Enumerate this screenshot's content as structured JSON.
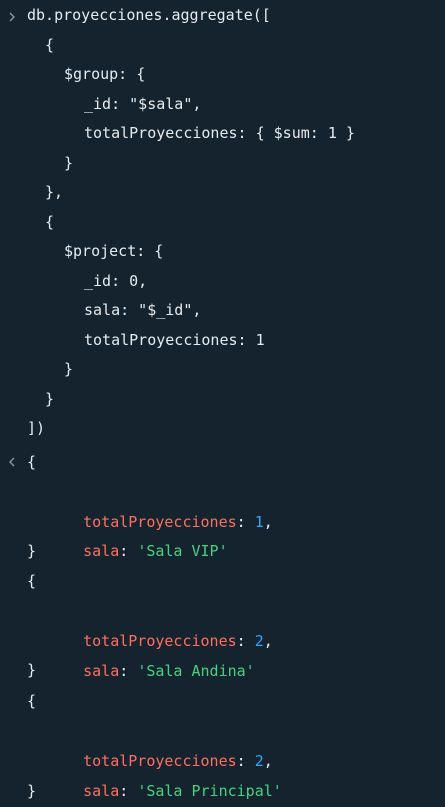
{
  "shell": {
    "prompt_icon": "chevron-right-icon",
    "result_icon": "chevron-left-icon",
    "command_lines": [
      "db.proyecciones.aggregate([",
      "{",
      "$group: {",
      "_id: \"$sala\",",
      "totalProyecciones: { $sum: 1 }",
      "}",
      "},",
      "{",
      "$project: {",
      "_id: 0,",
      "sala: \"$_id\",",
      "totalProyecciones: 1",
      "}",
      "}",
      "])"
    ],
    "results": [
      {
        "open": "{",
        "key1": "totalProyecciones",
        "sep1": ": ",
        "val1": "1",
        "tail1": ",",
        "key2": "sala",
        "sep2": ": ",
        "val2": "'Sala VIP'",
        "close": "}"
      },
      {
        "open": "{",
        "key1": "totalProyecciones",
        "sep1": ": ",
        "val1": "2",
        "tail1": ",",
        "key2": "sala",
        "sep2": ": ",
        "val2": "'Sala Andina'",
        "close": "}"
      },
      {
        "open": "{",
        "key1": "totalProyecciones",
        "sep1": ": ",
        "val1": "2",
        "tail1": ",",
        "key2": "sala",
        "sep2": ": ",
        "val2": "'Sala Principal'",
        "close": "}"
      }
    ]
  },
  "colors": {
    "background": "#15232e",
    "text": "#e6ebef",
    "key": "#ff6f61",
    "number": "#2fa7ff",
    "string": "#46d37f",
    "marker": "#8c98a2"
  }
}
